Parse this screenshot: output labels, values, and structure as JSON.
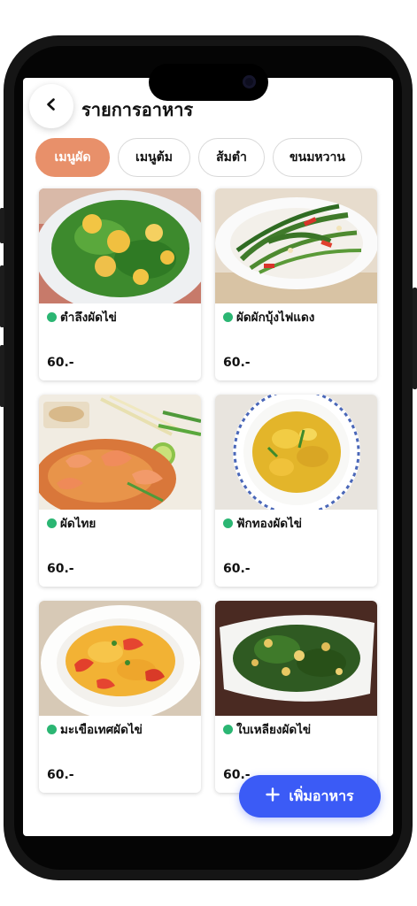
{
  "header": {
    "title": "รายการอาหาร",
    "back_icon": "chevron-left-icon"
  },
  "tabs": [
    {
      "label": "เมนูผัด",
      "active": true
    },
    {
      "label": "เมนูต้ม",
      "active": false
    },
    {
      "label": "ส้มตำ",
      "active": false
    },
    {
      "label": "ขนมหวาน",
      "active": false
    }
  ],
  "menu_items": [
    {
      "name": "ตำลึงผัดไข่",
      "price": "60.-",
      "status_color": "#2bb673"
    },
    {
      "name": "ผัดผักบุ้งไฟแดง",
      "price": "60.-",
      "status_color": "#2bb673"
    },
    {
      "name": "ผัดไทย",
      "price": "60.-",
      "status_color": "#2bb673"
    },
    {
      "name": "ฟักทองผัดไข่",
      "price": "60.-",
      "status_color": "#2bb673"
    },
    {
      "name": "มะเขือเทศผัดไข่",
      "price": "60.-",
      "status_color": "#2bb673"
    },
    {
      "name": "ใบเหลียงผัดไข่",
      "price": "60.-",
      "status_color": "#2bb673"
    }
  ],
  "fab": {
    "label": "เพิ่มอาหาร",
    "icon": "plus-icon"
  },
  "colors": {
    "accent_tab": "#e8906a",
    "primary": "#3b5bf6",
    "available": "#2bb673"
  }
}
